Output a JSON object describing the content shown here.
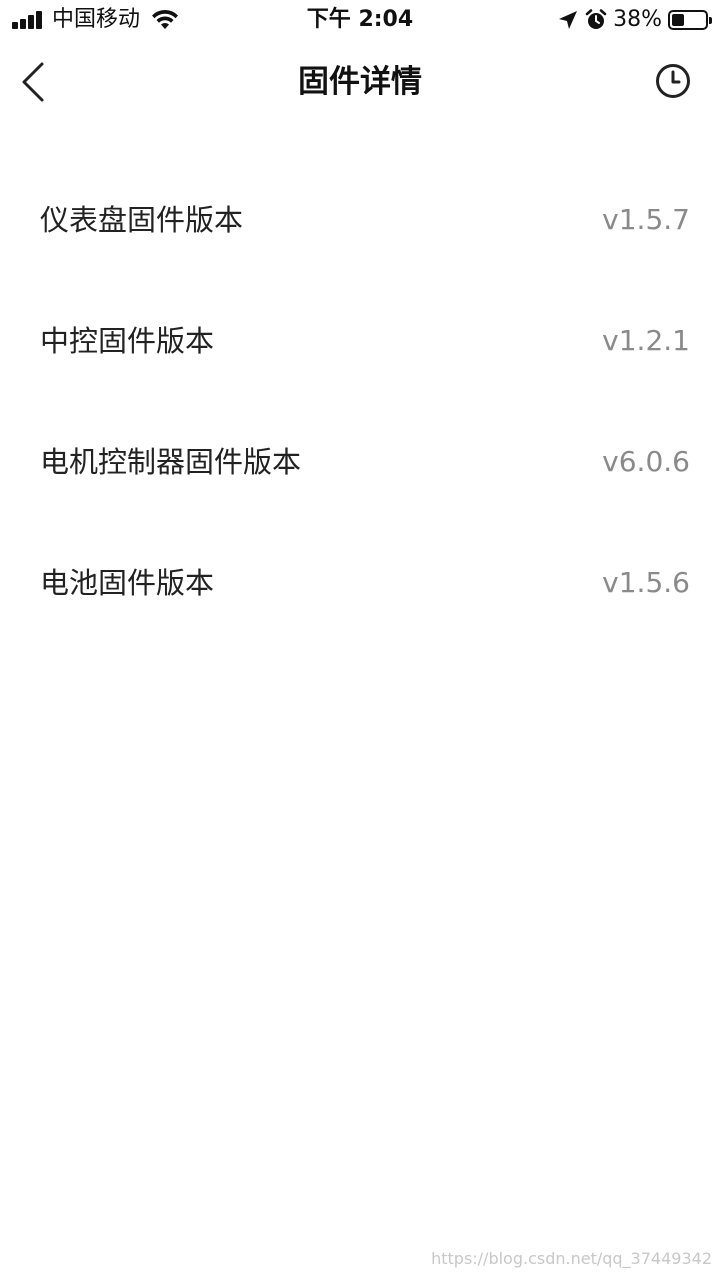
{
  "status_bar": {
    "carrier": "中国移动",
    "time": "下午 2:04",
    "battery_percent": "38%",
    "battery_level": 0.38,
    "icons": [
      "signal-icon",
      "wifi-icon",
      "location-arrow-icon",
      "alarm-clock-icon",
      "battery-icon"
    ]
  },
  "nav": {
    "title": "固件详情",
    "back_icon": "chevron-left-icon",
    "history_icon": "clock-icon"
  },
  "firmware_list": [
    {
      "label": "仪表盘固件版本",
      "value": "v1.5.7"
    },
    {
      "label": "中控固件版本",
      "value": "v1.2.1"
    },
    {
      "label": "电机控制器固件版本",
      "value": "v6.0.6"
    },
    {
      "label": "电池固件版本",
      "value": "v1.5.6"
    }
  ],
  "watermark": "https://blog.csdn.net/qq_37449342",
  "colors": {
    "background": "#ffffff",
    "title_text": "#111111",
    "label_text": "#222222",
    "value_text": "#8a8a8a"
  }
}
